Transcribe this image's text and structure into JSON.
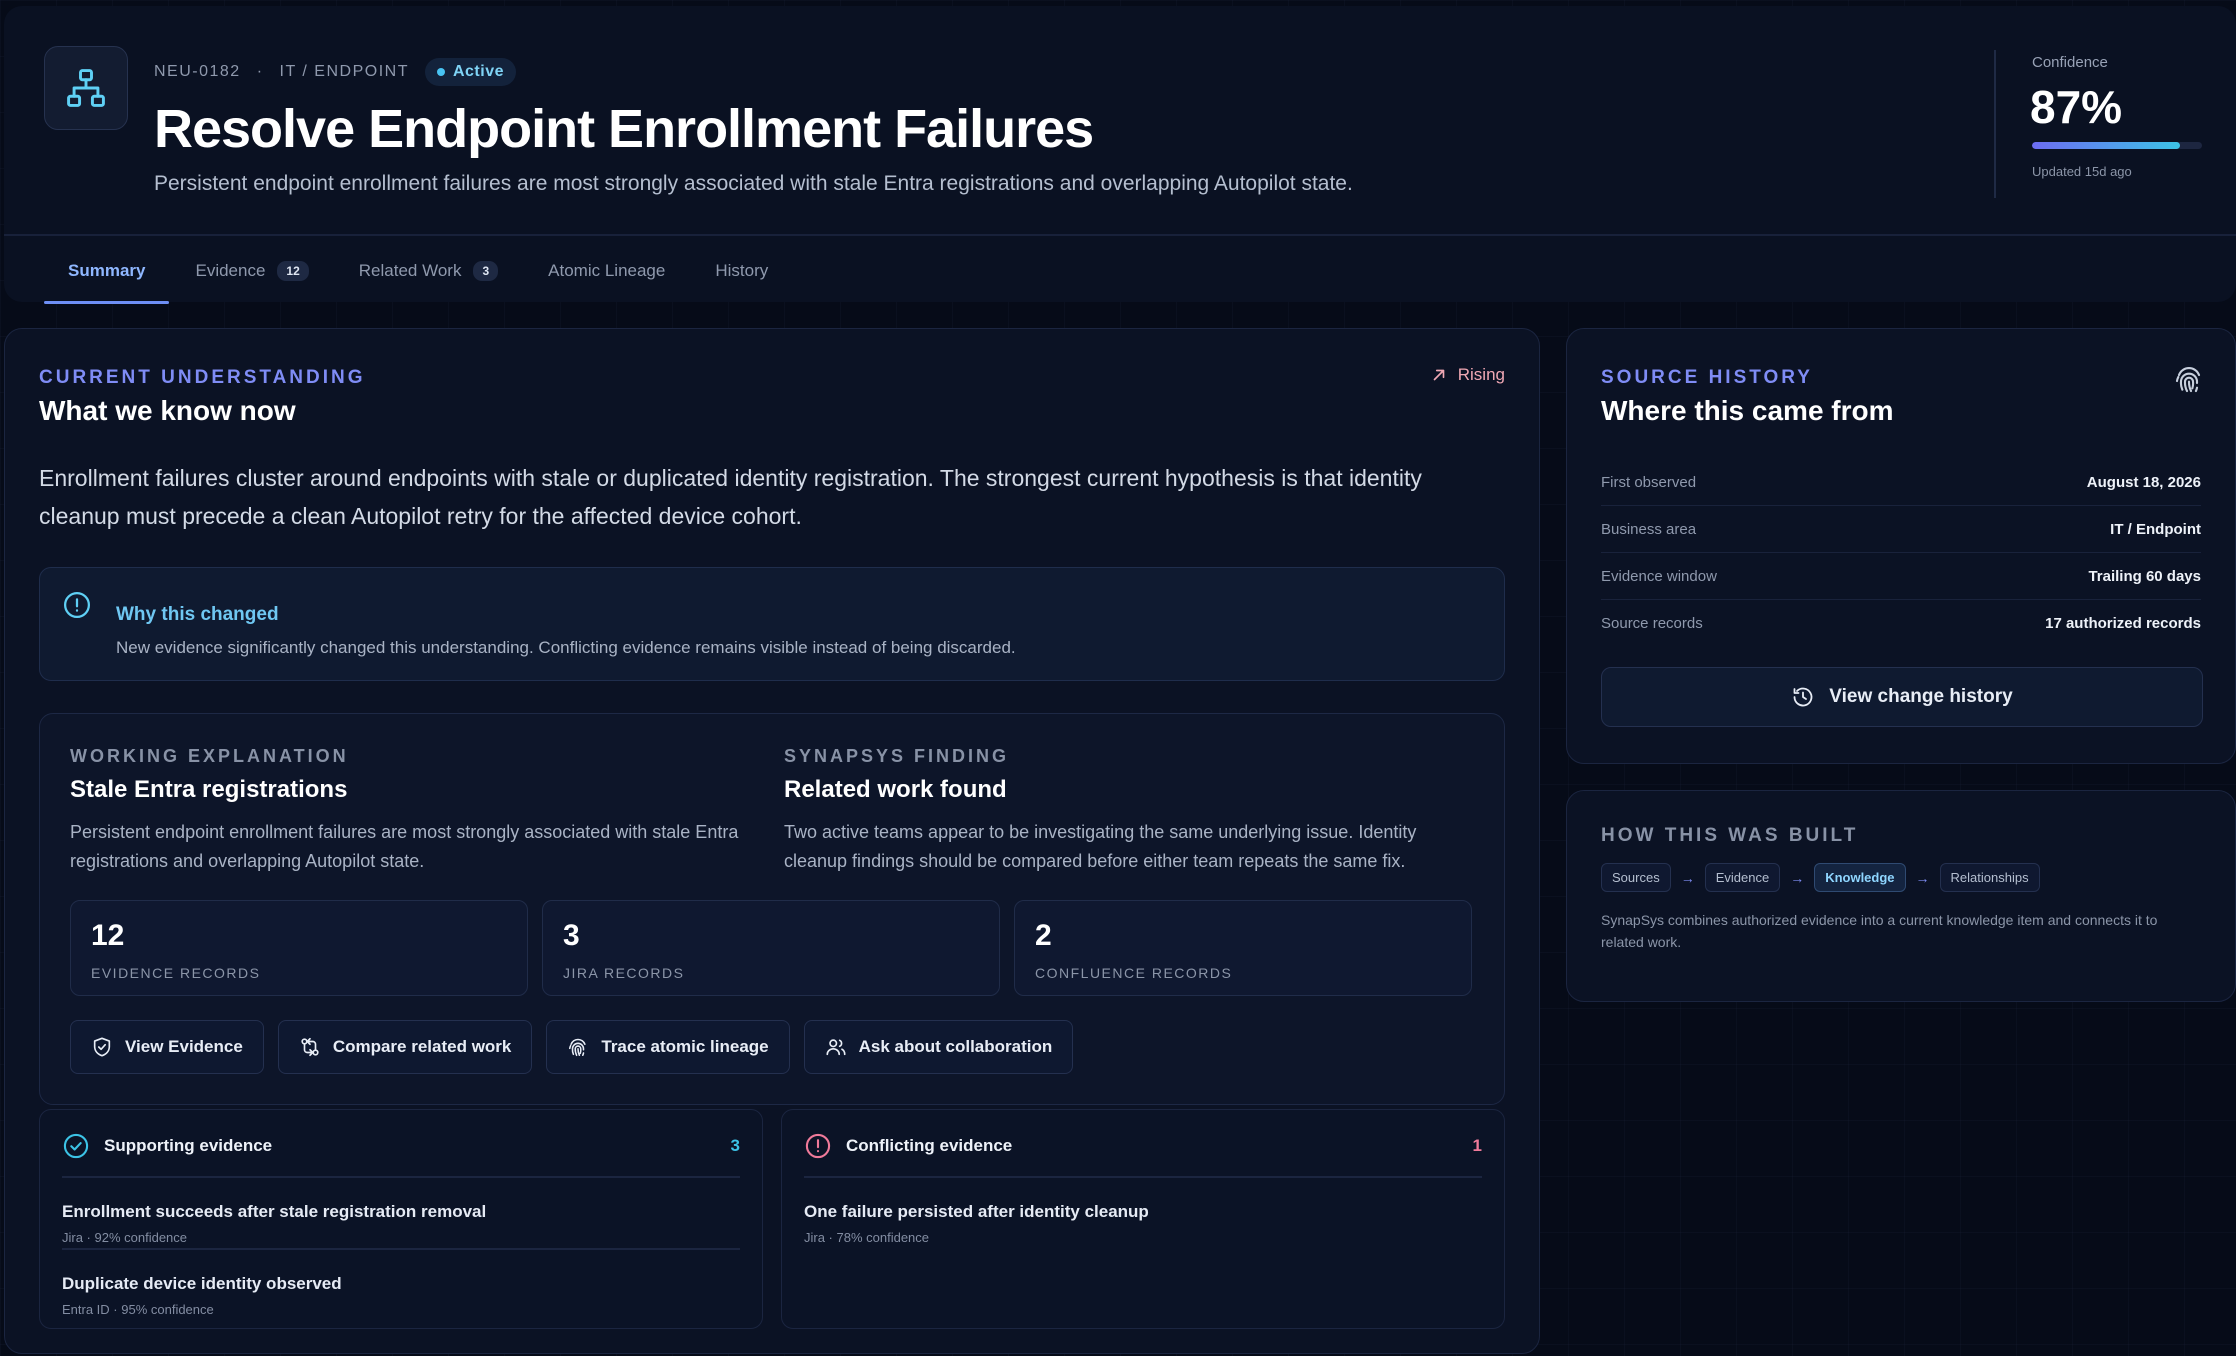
{
  "header": {
    "item_id": "NEU-0182",
    "separator": "·",
    "category": "IT / ENDPOINT",
    "status": "Active",
    "title": "Resolve Endpoint Enrollment Failures",
    "subtitle": "Persistent endpoint enrollment failures are most strongly associated with stale Entra registrations and overlapping Autopilot state.",
    "confidence_label": "Confidence",
    "confidence_value": "87%",
    "confidence_fraction": 0.87,
    "updated": "Updated 15d ago"
  },
  "tabs": [
    {
      "label": "Summary",
      "badge": null,
      "active": true
    },
    {
      "label": "Evidence",
      "badge": "12",
      "active": false
    },
    {
      "label": "Related Work",
      "badge": "3",
      "active": false
    },
    {
      "label": "Atomic Lineage",
      "badge": null,
      "active": false
    },
    {
      "label": "History",
      "badge": null,
      "active": false
    }
  ],
  "understanding": {
    "eyebrow": "CURRENT UNDERSTANDING",
    "heading": "What we know now",
    "trend": "Rising",
    "lead": "Enrollment failures cluster around endpoints with stale or duplicated identity registration. The strongest current hypothesis is that identity cleanup must precede a clean Autopilot retry for the affected device cohort.",
    "why_title": "Why this changed",
    "why_text": "New evidence significantly changed this understanding. Conflicting evidence remains visible instead of being discarded."
  },
  "explanation": {
    "left_eyebrow": "WORKING EXPLANATION",
    "left_heading": "Stale Entra registrations",
    "left_text": "Persistent endpoint enrollment failures are most strongly associated with stale Entra registrations and overlapping Autopilot state.",
    "right_eyebrow": "SYNAPSYS FINDING",
    "right_heading": "Related work found",
    "right_text": "Two active teams appear to be investigating the same underlying issue. Identity cleanup findings should be compared before either team repeats the same fix.",
    "stats": [
      {
        "value": "12",
        "label": "EVIDENCE RECORDS"
      },
      {
        "value": "3",
        "label": "JIRA RECORDS"
      },
      {
        "value": "2",
        "label": "CONFLUENCE RECORDS"
      }
    ],
    "actions": [
      {
        "label": "View Evidence",
        "icon": "shield-check-icon"
      },
      {
        "label": "Compare related work",
        "icon": "compare-arrows-icon"
      },
      {
        "label": "Trace atomic lineage",
        "icon": "fingerprint-icon"
      },
      {
        "label": "Ask about collaboration",
        "icon": "users-icon"
      }
    ]
  },
  "supporting": {
    "title": "Supporting evidence",
    "count": "3",
    "color": "#3cc3e6",
    "items": [
      {
        "title": "Enrollment succeeds after stale registration removal",
        "meta": "Jira · 92% confidence"
      },
      {
        "title": "Duplicate device identity observed",
        "meta": "Entra ID · 95% confidence"
      }
    ]
  },
  "conflicting": {
    "title": "Conflicting evidence",
    "count": "1",
    "color": "#f07a9a",
    "items": [
      {
        "title": "One failure persisted after identity cleanup",
        "meta": "Jira · 78% confidence"
      }
    ]
  },
  "source_history": {
    "eyebrow": "SOURCE HISTORY",
    "heading": "Where this came from",
    "rows": [
      {
        "key": "First observed",
        "value": "August 18, 2026"
      },
      {
        "key": "Business area",
        "value": "IT / Endpoint"
      },
      {
        "key": "Evidence window",
        "value": "Trailing 60 days"
      },
      {
        "key": "Source records",
        "value": "17 authorized records"
      }
    ],
    "button": "View change history"
  },
  "how_built": {
    "eyebrow": "HOW THIS WAS BUILT",
    "pipeline": [
      "Sources",
      "Evidence",
      "Knowledge",
      "Relationships"
    ],
    "arrow": "→",
    "active_step": "Knowledge",
    "text": "SynapSys combines authorized evidence into a current knowledge item and connects it to related work."
  },
  "colors": {
    "accent": "#7f8cf5",
    "cyan": "#48c3f2",
    "background": "#060b18"
  }
}
